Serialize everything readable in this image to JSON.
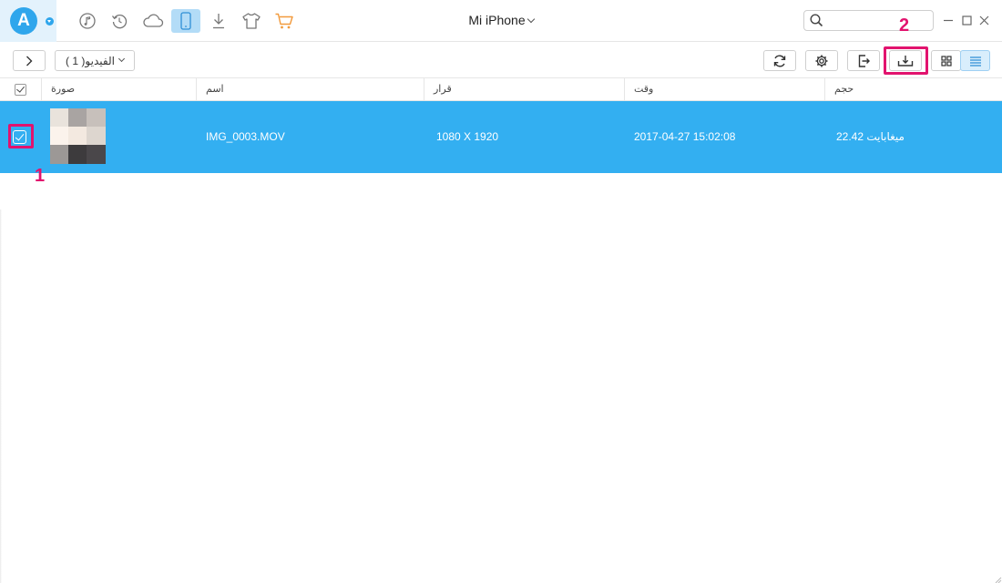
{
  "app": {
    "logo_letter": "A",
    "device_name": "Mi iPhone",
    "accent": "#2fa6ec",
    "highlight_color": "#e2136e"
  },
  "nav_icons": [
    "music-icon",
    "restore-icon",
    "cloud-icon",
    "phone-icon",
    "download-icon",
    "tshirt-icon",
    "cart-icon"
  ],
  "search": {
    "placeholder": "",
    "value": ""
  },
  "toolbar": {
    "category_label": "الفيديو( 1 )",
    "buttons": [
      "refresh-icon",
      "settings-icon",
      "export-to-device-icon",
      "export-to-pc-icon",
      "grid-view-icon",
      "list-view-icon"
    ]
  },
  "table": {
    "columns": [
      "صورة",
      "اسم",
      "قرار",
      "وقت",
      "حجم"
    ],
    "rows": [
      {
        "name": "IMG_0003.MOV",
        "resolution": "1080 X 1920",
        "time": "2017-04-27 15:02:08",
        "size": "ميغابايت 22.42",
        "selected": true
      }
    ]
  },
  "annotations": {
    "step1": "1",
    "step2": "2"
  }
}
